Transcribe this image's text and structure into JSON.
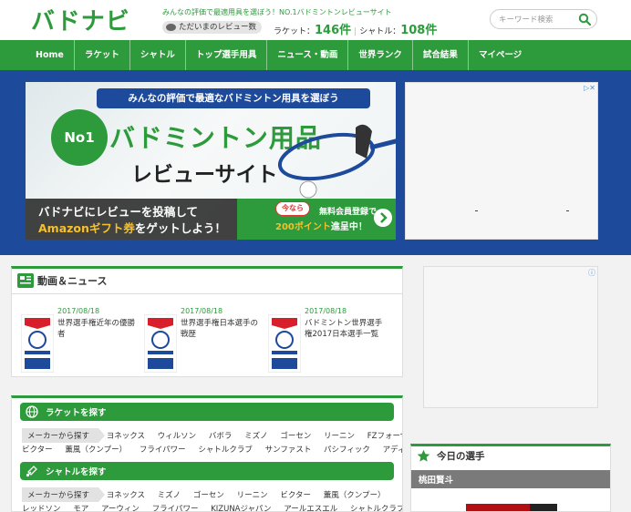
{
  "header": {
    "logo": "バドナビ",
    "tagline": "みんなの評価で最適用具を選ぼう！NO.1バドミントンレビューサイト",
    "review_badge": "ただいまのレビュー数",
    "racket_label": "ラケット：",
    "racket_count": "146件",
    "shuttle_label": "シャトル：",
    "shuttle_count": "108件",
    "search_placeholder": "キーワード検索"
  },
  "nav": {
    "items": [
      "Home",
      "ラケット",
      "シャトル",
      "トップ選手用具",
      "ニュース・動画",
      "世界ランク",
      "試合結果",
      "マイページ"
    ]
  },
  "banner": {
    "top_text": "みんなの評価で最適なバドミントン用具を選ぼう",
    "no1": "No1",
    "title": "バドミントン用品",
    "subtitle": "レビューサイト",
    "bottom_line1": "バドナビにレビューを投稿して",
    "bottom_amazon": "Amazonギフト券",
    "bottom_line2_rest": "をゲットしよう！",
    "now_badge": "今なら",
    "free_reg": "無料会員登録で",
    "points": "200ポイント",
    "points_rest": "進呈中！"
  },
  "news": {
    "title": "動画＆ニュース",
    "items": [
      {
        "date": "2017/08/18",
        "title": "世界選手権近年の優勝者"
      },
      {
        "date": "2017/08/18",
        "title": "世界選手権日本選手の戦歴"
      },
      {
        "date": "2017/08/18",
        "title": "バドミントン世界選手権2017日本選手一覧"
      }
    ]
  },
  "racket_section": {
    "title": "ラケットを探す",
    "maker_label": "メーカーから探す",
    "brands_row1": [
      "ヨネックス",
      "ウィルソン",
      "バボラ",
      "ミズノ",
      "ゴーセン",
      "リーニン",
      "FZフォーザ"
    ],
    "brands_row2": [
      "ビクター",
      "薫風（クンプー）",
      "フライパワー",
      "シャトルクラブ",
      "サンファスト",
      "パシフィック",
      "アディダス"
    ]
  },
  "shuttle_section": {
    "title": "シャトルを探す",
    "maker_label": "メーカーから探す",
    "brands_row1": [
      "ヨネックス",
      "ミズノ",
      "ゴーセン",
      "リーニン",
      "ビクター",
      "薫風（クンプー）"
    ],
    "brands_row2": [
      "レッドソン",
      "モア",
      "アーウィン",
      "フライパワー",
      "KIZUNAジャパン",
      "アールエスエル",
      "シャトルクラブ"
    ]
  },
  "today": {
    "title": "今日の選手",
    "player": "桃田賢斗"
  },
  "colors": {
    "brand_green": "#2d9a3b",
    "banner_blue": "#1d4a9b",
    "amazon_yellow": "#f5c12b"
  }
}
